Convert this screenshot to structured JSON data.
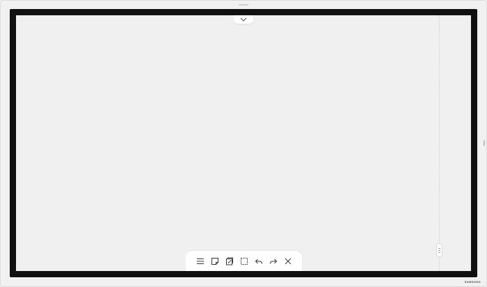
{
  "device": {
    "brand": "SAMSUNG",
    "bezel_color": "#111111",
    "frame_color": "#f1f1f1"
  },
  "canvas": {
    "background_color": "#f0f0f0",
    "top_handle_icon": "chevron-down-icon"
  },
  "toolbar": {
    "tools": [
      {
        "name": "menu",
        "icon": "menu-icon"
      },
      {
        "name": "sticky-note",
        "icon": "sticky-note-icon"
      },
      {
        "name": "import-note",
        "icon": "note-edit-icon"
      },
      {
        "name": "select",
        "icon": "selection-icon"
      },
      {
        "name": "undo",
        "icon": "undo-icon"
      },
      {
        "name": "redo",
        "icon": "redo-icon"
      },
      {
        "name": "close",
        "icon": "close-icon"
      }
    ]
  }
}
